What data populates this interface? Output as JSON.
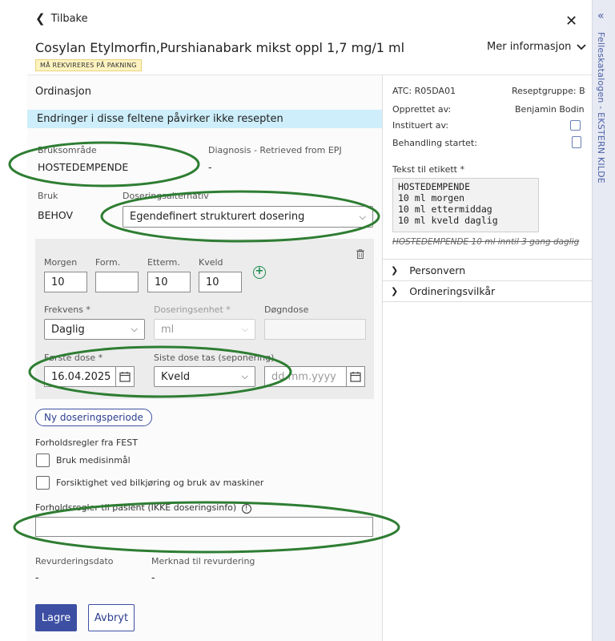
{
  "header": {
    "back_label": "Tilbake",
    "title": "Cosylan Etylmorfin,Purshianabark  mikst oppl 1,7 mg/1 ml",
    "badge": "MÅ REKVIRERES PÅ PAKNING",
    "more_info": "Mer informasjon"
  },
  "ordinasjon": {
    "section_title": "Ordinasjon",
    "banner": "Endringer i disse feltene påvirker ikke resepten",
    "bruksomrade_label": "Bruksområde",
    "bruksomrade_value": "HOSTEDEMPENDE",
    "diagnosis_label": "Diagnosis - Retrieved from EPJ",
    "diagnosis_value": "-",
    "bruk_label": "Bruk",
    "bruk_value": "BEHOV",
    "dosering_label": "Doseringsalternativ",
    "dosering_value": "Egendefinert strukturert dosering"
  },
  "dose": {
    "morgen_label": "Morgen",
    "morgen_value": "10",
    "form_label": "Form.",
    "form_value": "",
    "etterm_label": "Etterm.",
    "etterm_value": "10",
    "kveld_label": "Kveld",
    "kveld_value": "10",
    "frekvens_label": "Frekvens *",
    "frekvens_value": "Daglig",
    "enhet_label": "Doseringsenhet *",
    "enhet_value": "ml",
    "dognedose_label": "Døgndose",
    "forste_label": "Første dose *",
    "forste_value": "16.04.2025",
    "siste_label": "Siste dose tas (seponering)",
    "siste_value": "Kveld",
    "date_placeholder": "dd.mm.yyyy"
  },
  "new_period_button": "Ny doseringsperiode",
  "fest": {
    "title": "Forholdsregler fra FEST",
    "check1": "Bruk medisinmål",
    "check2": "Forsiktighet ved bilkjøring og bruk av maskiner"
  },
  "patient_precautions_label": "Forholdsregler til pasient (IKKE doseringsinfo)",
  "revurdering": {
    "date_label": "Revurderingsdato",
    "date_value": "-",
    "note_label": "Merknad til revurdering",
    "note_value": "-"
  },
  "actions": {
    "save": "Lagre",
    "cancel": "Avbryt"
  },
  "right": {
    "atc": "ATC: R05DA01",
    "reseptgruppe": "Reseptgruppe: B",
    "opprettet_label": "Opprettet av:",
    "opprettet_value": "Benjamin Bodin",
    "instituert_label": "Instituert av:",
    "behandling_label": "Behandling startet:",
    "label_text_title": "Tekst til etikett *",
    "label_text": "HOSTEDEMPENDE\n10 ml morgen\n10 ml ettermiddag\n10 ml kveld daglig",
    "struck_text": "HOSTEDEMPENDE 10 ml inntil 3 gang daglig",
    "personvern": "Personvern",
    "ordineringsvilkar": "Ordineringsvilkår"
  },
  "side_panel": {
    "label": "Felleskatalogen - EKSTERN KILDE"
  },
  "colors": {
    "primary": "#3c4fa3",
    "banner": "#cdeefa",
    "badge": "#fdf3c0",
    "annotation": "#2e7d32"
  }
}
